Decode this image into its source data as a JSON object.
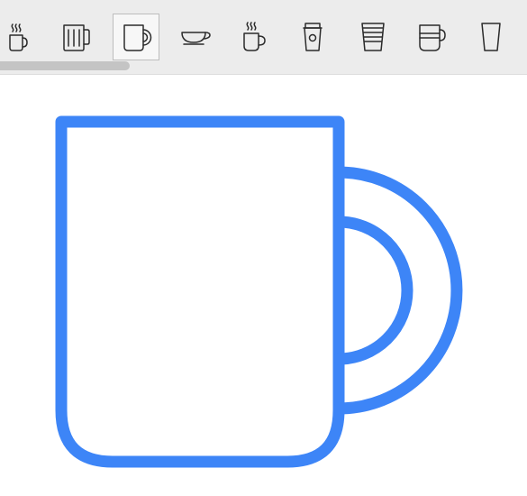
{
  "toolbar": {
    "items": [
      {
        "icon": "steaming-mug-icon",
        "selected": false
      },
      {
        "icon": "beer-stein-icon",
        "selected": false
      },
      {
        "icon": "mug-icon",
        "selected": true
      },
      {
        "icon": "teacup-saucer-icon",
        "selected": false
      },
      {
        "icon": "steaming-cup-icon",
        "selected": false
      },
      {
        "icon": "takeaway-cup-icon",
        "selected": false
      },
      {
        "icon": "striped-cup-icon",
        "selected": false
      },
      {
        "icon": "banded-mug-icon",
        "selected": false
      },
      {
        "icon": "glass-icon",
        "selected": false
      }
    ]
  },
  "preview": {
    "icon": "mug-icon",
    "color": "#3d85f7"
  }
}
